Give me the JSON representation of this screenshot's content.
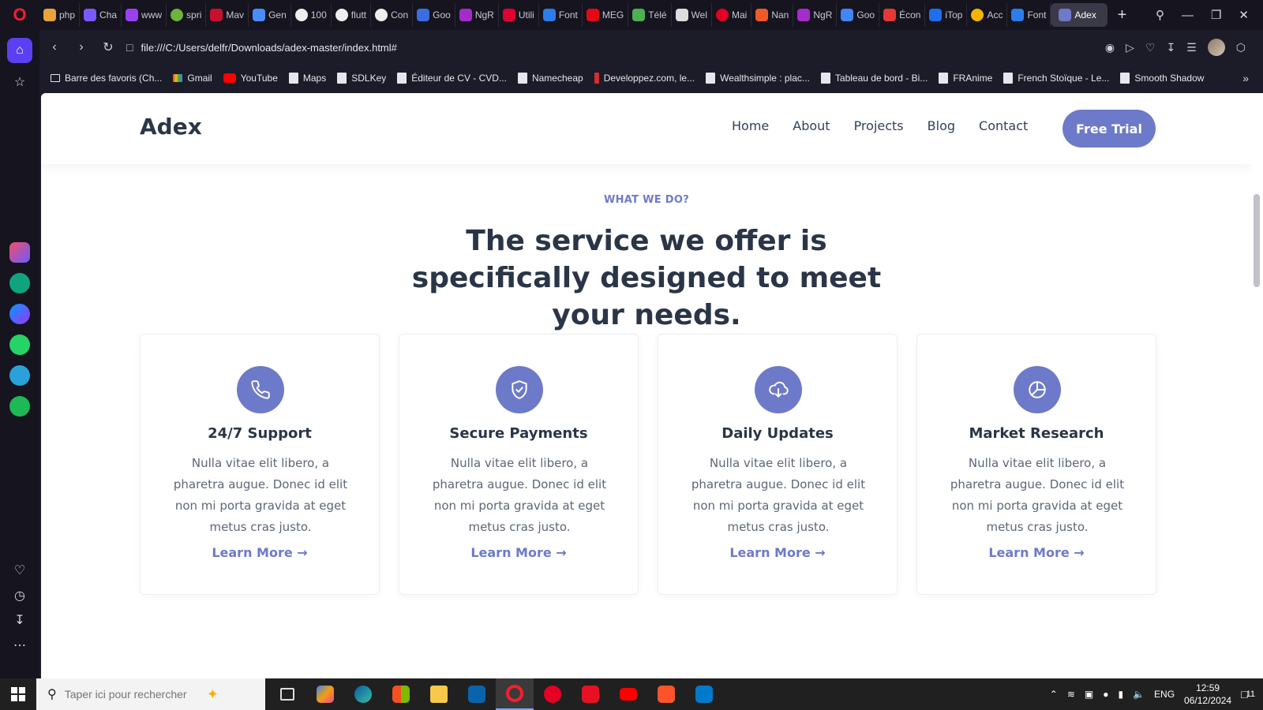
{
  "browser": {
    "tabs": [
      "php",
      "Cha",
      "www",
      "spri",
      "Mav",
      "Gen",
      "100",
      "flutt",
      "Con",
      "Goo",
      "NgR",
      "Utili",
      "Font",
      "MEG",
      "Télé",
      "Wel",
      "Mai",
      "Nan",
      "NgR",
      "Goo",
      "Écon",
      "iTop",
      "Acc",
      "Font"
    ],
    "active_tab": "Adex",
    "url": "file:///C:/Users/delfr/Downloads/adex-master/index.html#",
    "bookmarks": [
      "Barre des favoris (Ch...",
      "Gmail",
      "YouTube",
      "Maps",
      "SDLKey",
      "Éditeur de CV - CVD...",
      "Namecheap",
      "Developpez.com, le...",
      "Wealthsimple : plac...",
      "Tableau de bord - Bi...",
      "FRAnime",
      "French Stoïque - Le...",
      "Smooth Shadow"
    ]
  },
  "site": {
    "logo": "Adex",
    "nav": [
      "Home",
      "About",
      "Projects",
      "Blog",
      "Contact"
    ],
    "cta": "Free Trial",
    "kicker": "WHAT WE DO?",
    "headline": "The service we offer is specifically designed to meet your needs.",
    "cards": [
      {
        "icon": "phone-icon",
        "title": "24/7 Support",
        "text": "Nulla vitae elit libero, a pharetra augue. Donec id elit non mi porta gravida at eget metus cras justo.",
        "link": "Learn More →"
      },
      {
        "icon": "shield-check-icon",
        "title": "Secure Payments",
        "text": "Nulla vitae elit libero, a pharetra augue. Donec id elit non mi porta gravida at eget metus cras justo.",
        "link": "Learn More →"
      },
      {
        "icon": "cloud-download-icon",
        "title": "Daily Updates",
        "text": "Nulla vitae elit libero, a pharetra augue. Donec id elit non mi porta gravida at eget metus cras justo.",
        "link": "Learn More →"
      },
      {
        "icon": "pie-chart-icon",
        "title": "Market Research",
        "text": "Nulla vitae elit libero, a pharetra augue. Donec id elit non mi porta gravida at eget metus cras justo.",
        "link": "Learn More →"
      }
    ],
    "accent_color": "#6d7ac9",
    "heading_color": "#2a3547"
  },
  "taskbar": {
    "search_placeholder": "Taper ici pour rechercher",
    "language": "ENG",
    "time": "12:59",
    "date": "06/12/2024",
    "notifications": "11"
  }
}
